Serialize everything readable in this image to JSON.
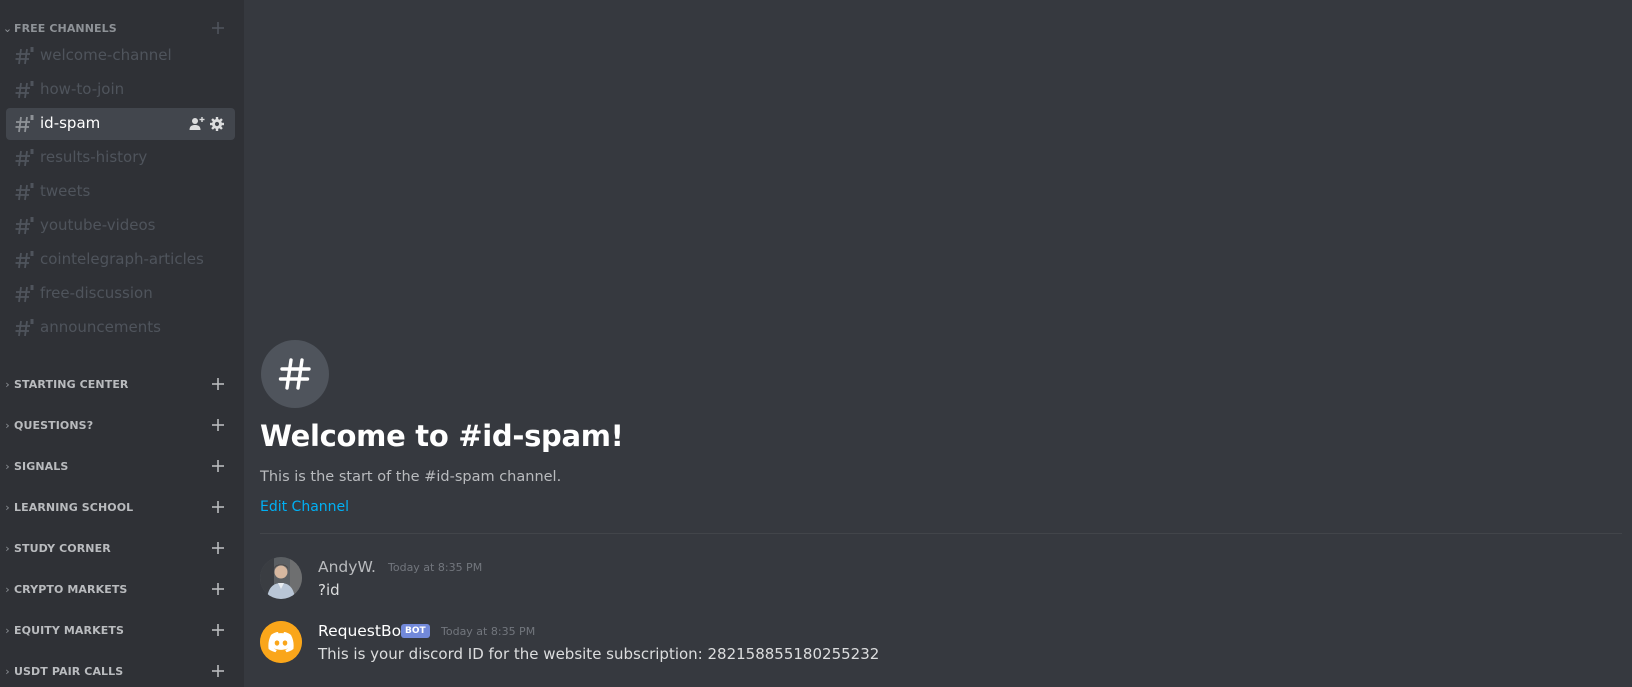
{
  "sidebar": {
    "categories": [
      {
        "label": "FREE CHANNELS",
        "state": "expanded"
      },
      {
        "label": "STARTING CENTER",
        "state": "collapsed"
      },
      {
        "label": "QUESTIONS?",
        "state": "collapsed"
      },
      {
        "label": "SIGNALS",
        "state": "collapsed"
      },
      {
        "label": "LEARNING SCHOOL",
        "state": "collapsed"
      },
      {
        "label": "STUDY CORNER",
        "state": "collapsed"
      },
      {
        "label": "CRYPTO MARKETS",
        "state": "collapsed"
      },
      {
        "label": "EQUITY MARKETS",
        "state": "collapsed"
      },
      {
        "label": "USDT PAIR CALLS",
        "state": "collapsed"
      }
    ],
    "channels": [
      {
        "label": "welcome-channel",
        "locked": true
      },
      {
        "label": "how-to-join",
        "locked": true
      },
      {
        "label": "id-spam",
        "locked": true,
        "active": true
      },
      {
        "label": "results-history",
        "locked": true
      },
      {
        "label": "tweets",
        "locked": true
      },
      {
        "label": "youtube-videos",
        "locked": true
      },
      {
        "label": "cointelegraph-articles",
        "locked": true
      },
      {
        "label": "free-discussion",
        "locked": true
      },
      {
        "label": "announcements",
        "locked": true
      }
    ],
    "active_channel_icons": [
      "invite-icon",
      "settings-gear-icon"
    ]
  },
  "welcome": {
    "badge_icon": "hash-icon",
    "title": "Welcome to #id-spam!",
    "subtitle": "This is the start of the #id-spam channel.",
    "edit_link": "Edit Channel"
  },
  "messages": [
    {
      "author": "AndyW.",
      "timestamp": "Today at 8:35 PM",
      "text": "?id",
      "avatar": "user-photo-avatar",
      "name_color": "#b9bbbe"
    },
    {
      "author": "RequestBot",
      "tag": "BOT",
      "timestamp": "Today at 8:35 PM",
      "text": "This is your discord ID for the website subscription: 282158855180255232",
      "avatar": "discord-logo-avatar",
      "avatar_color": "#faa61a",
      "name_color": "#ffffff"
    }
  ],
  "colors": {
    "sidebar_bg": "#2f3136",
    "main_bg": "#36393f",
    "link": "#00b0f4",
    "bot_tag": "#7289da"
  }
}
